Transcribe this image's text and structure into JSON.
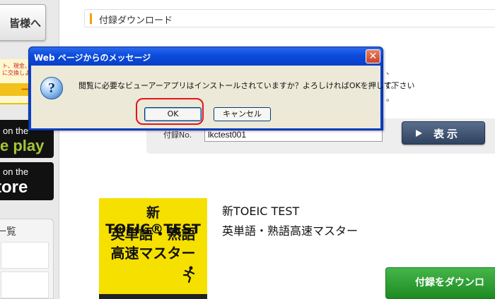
{
  "sidebar": {
    "guest_button": "皆様へ",
    "promo_small": "ト、現金、電子\nに交換しよう",
    "promo_big": "ーン実",
    "google_play": {
      "small": "on the",
      "big": "e play"
    },
    "app_store": {
      "small": "on the",
      "big": "tore"
    },
    "list_title": "一覧"
  },
  "section": {
    "title": "付録ダウンロード"
  },
  "background_fragments": {
    "line1": "、",
    "line2": "す。",
    "line3": "。"
  },
  "form": {
    "appendix_label": "付録No.",
    "appendix_value": "lkctest001",
    "display_button": "表示"
  },
  "book": {
    "cover_line1": "新TOEIC®TEST",
    "cover_line2": "英単語・熟語",
    "cover_line3": "高速マスター",
    "title_line1": "新TOEIC TEST",
    "title_line2": "英単語・熟語高速マスター"
  },
  "download_button": "付録をダウンロ",
  "dialog": {
    "title": "Web ページからのメッセージ",
    "close_symbol": "✕",
    "icon": "question-icon",
    "message": "閲覧に必要なビューアーアプリはインストールされていますか？よろしければOKを押して下さい",
    "ok_label": "OK",
    "cancel_label": "キャンセル"
  },
  "colors": {
    "dialog_titlebar": "#0b4bdc",
    "dialog_body": "#ece9d8",
    "highlight": "#e8101e",
    "download_green": "#2e9e33",
    "display_button_navy": "#3a4e6d",
    "book_yellow": "#f5e000"
  }
}
